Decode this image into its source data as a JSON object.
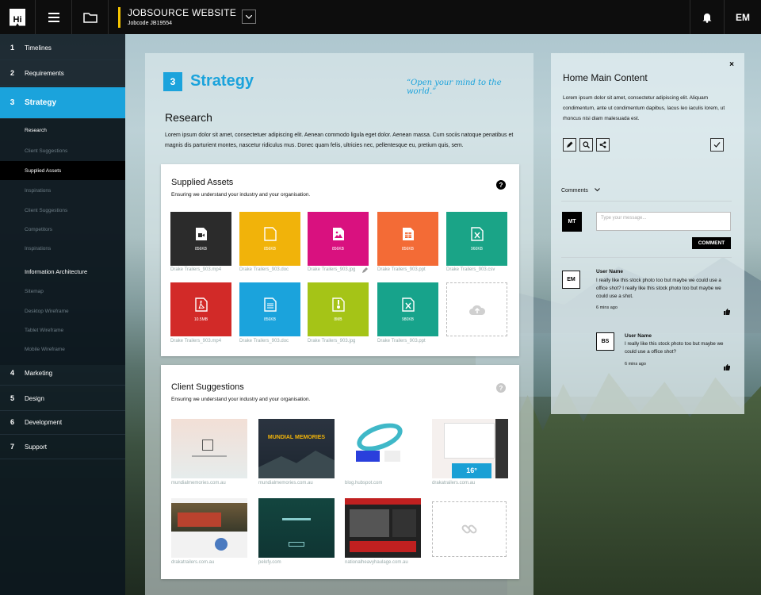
{
  "header": {
    "logo": "Hi",
    "project_title": "JOBSOURCE WEBSITE",
    "jobcode": "Jobcode  JB19554",
    "user_initials": "EM"
  },
  "sidebar": {
    "items": [
      {
        "num": "1",
        "label": "Timelines"
      },
      {
        "num": "2",
        "label": "Requirements"
      },
      {
        "num": "3",
        "label": "Strategy"
      },
      {
        "num": "4",
        "label": "Marketing"
      },
      {
        "num": "5",
        "label": "Design"
      },
      {
        "num": "6",
        "label": "Development"
      },
      {
        "num": "7",
        "label": "Support"
      }
    ],
    "subitems": [
      "Research",
      "Client Suggestions",
      "Supplied Assets",
      "Inspirations",
      "Client Suggestions",
      "Competitors",
      "Inspirations",
      "Information Architecture",
      "Sitemap",
      "Desktop Wireframe",
      "Tablet Wireframe",
      "Mobile Wireframe"
    ]
  },
  "main": {
    "step_number": "3",
    "title": "Strategy",
    "quote": "“Open your mind to the world.”",
    "research_heading": "Research",
    "research_text": "Lorem ipsum dolor sit amet, consectetuer adipiscing elit. Aenean commodo ligula eget dolor. Aenean massa.  Cum sociis natoque penatibus et magnis dis parturient montes, nascetur ridiculus mus. Donec quam felis, ultricies nec, pellentesque eu, pretium quis, sem.",
    "supplied_assets": {
      "title": "Supplied Assets",
      "subtitle": "Ensuring we understand your industry and your organisation.",
      "help": "?",
      "tiles": [
        {
          "size": "856KB",
          "name": "Drake Trailers_903.mp4",
          "color": "#2b2b2b",
          "icon": "video-icon"
        },
        {
          "size": "856KB",
          "name": "Drake Trailers_903.doc",
          "color": "#f1b30a",
          "icon": "doc-icon"
        },
        {
          "size": "856KB",
          "name": "Drake Trailers_903.jpg",
          "color": "#d9117f",
          "icon": "image-icon"
        },
        {
          "size": "856KB",
          "name": "Drake Trailers_903.ppt",
          "color": "#f36b36",
          "icon": "ppt-icon"
        },
        {
          "size": "960KB",
          "name": "Drake Trailers_903.csv",
          "color": "#1aa487",
          "icon": "excel-icon"
        },
        {
          "size": "10.5MB",
          "name": "Drake Trailers_903.mp4",
          "color": "#d22a28",
          "icon": "pdf-icon"
        },
        {
          "size": "856KB",
          "name": "Drake Trailers_903.doc",
          "color": "#1ba3dc",
          "icon": "doc-icon"
        },
        {
          "size": "8MB",
          "name": "Drake Trailers_903.jpg",
          "color": "#a5c417",
          "icon": "zip-icon"
        },
        {
          "size": "980KB",
          "name": "Drake Trailers_903.ppt",
          "color": "#17a38b",
          "icon": "excel-icon"
        }
      ]
    },
    "client_suggestions": {
      "title": "Client Suggestions",
      "subtitle": "Ensuring we understand your industry and your organisation.",
      "help": "?",
      "sites": [
        {
          "url": "mundialmemories.com.au"
        },
        {
          "url": "mundialmemories.com.au",
          "caption": "MUNDIAL MEMORIES"
        },
        {
          "url": "blog.hubspot.com"
        },
        {
          "url": "drakatrailers.com.au",
          "temp": "16°"
        },
        {
          "url": "drakatrailers.com.au"
        },
        {
          "url": "pelofy.com"
        },
        {
          "url": "nationalheavyhaulage.com.au"
        }
      ]
    }
  },
  "panel": {
    "close": "×",
    "title": "Home Main Content",
    "text": "Lorem ipsum dolor sit amet, consectetur adipiscing elit. Aliquam condimentum, ante ut condimentum dapibus, lacus leo iaculis lorem, ut rhoncus nisi diam malesuada est.",
    "comments_label": "Comments",
    "me_initials": "MT",
    "message_placeholder": "Type your message...",
    "comment_button": "COMMENT",
    "comments": [
      {
        "initials": "EM",
        "user": "User Name",
        "text": "I really like this stock photo too but maybe we could use a office shot? I really like this stock photo too but maybe we could use a shot.",
        "time": "6 mins ago"
      },
      {
        "initials": "BS",
        "user": "User Name",
        "text": "I really like this stock photo too but maybe we could use a office shot?",
        "time": "6 mins ago"
      }
    ]
  }
}
